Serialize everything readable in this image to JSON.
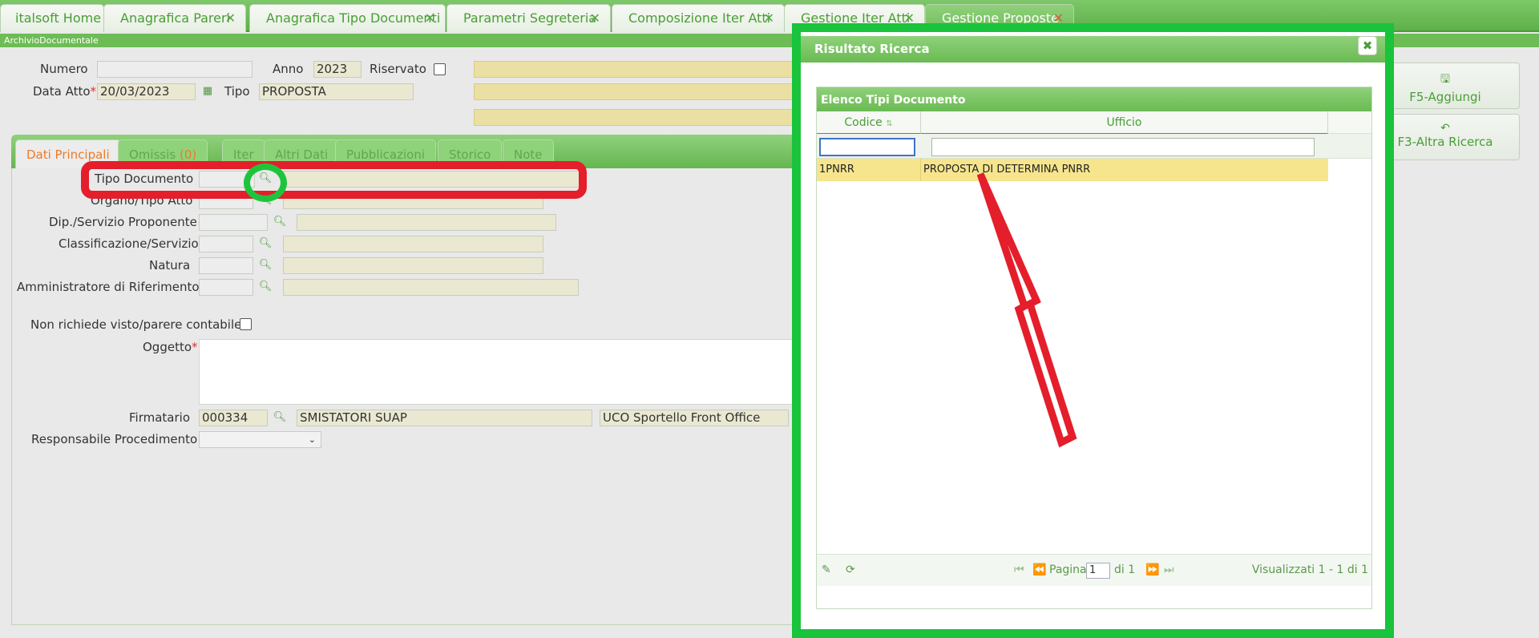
{
  "tabs": [
    {
      "label": "italsoft Home",
      "closable": false
    },
    {
      "label": "Anagrafica Pareri",
      "closable": true
    },
    {
      "label": "Anagrafica Tipo Documenti",
      "closable": true
    },
    {
      "label": "Parametri Segreteria",
      "closable": true
    },
    {
      "label": "Composizione Iter Atti",
      "closable": true
    },
    {
      "label": "Gestione Iter Atti",
      "closable": true
    },
    {
      "label": "Gestione Proposte",
      "closable": true,
      "active": true
    }
  ],
  "close_glyph": "✕",
  "subtitle": "ArchivioDocumentale",
  "form": {
    "numero_label": "Numero",
    "numero_value": "",
    "anno_label": "Anno",
    "anno_value": "2023",
    "riservato_label": "Riservato",
    "data_atto_label": "Data Atto",
    "data_atto_value": "20/03/2023",
    "tipo_label": "Tipo",
    "tipo_value": "PROPOSTA",
    "required_mark": "*"
  },
  "form_tabs": [
    {
      "label": "Dati Principali",
      "active": true
    },
    {
      "label": "Omissis",
      "count": "(0)"
    },
    {
      "label": "Iter"
    },
    {
      "label": "Altri Dati"
    },
    {
      "label": "Pubblicazioni"
    },
    {
      "label": "Storico"
    },
    {
      "label": "Note"
    }
  ],
  "fields": {
    "tipo_documento_label": "Tipo Documento",
    "organo_label": "Organo/Tipo Atto",
    "dip_label": "Dip./Servizio Proponente",
    "classificazione_label": "Classificazione/Servizio",
    "natura_label": "Natura",
    "amministratore_label": "Amministratore di Riferimento",
    "non_richiede_label": "Non richiede visto/parere contabile",
    "oggetto_label": "Oggetto",
    "firmatario_label": "Firmatario",
    "firmatario_code": "000334",
    "firmatario_name": "SMISTATORI SUAP",
    "firmatario_office": "UCO Sportello Front Office",
    "responsabile_label": "Responsabile Procedimento"
  },
  "actions": {
    "add_label": "F5-Aggiungi",
    "search_again_label": "F3-Altra Ricerca"
  },
  "dialog": {
    "title": "Risultato Ricerca",
    "close_label": "✖",
    "grid_caption": "Elenco Tipi Documento",
    "col_codice": "Codice",
    "col_ufficio": "Ufficio",
    "rows": [
      {
        "codice": "1PNRR",
        "ufficio": "PROPOSTA DI DETERMINA PNRR"
      }
    ],
    "pager": {
      "page_label": "Pagina",
      "page_value": "1",
      "of_label": "di 1",
      "summary": "Visualizzati 1 - 1 di 1"
    }
  },
  "icons": {
    "search": "search-icon",
    "calendar": "calendar-icon",
    "save": "save-icon",
    "undo": "undo-icon",
    "edit": "pencil-icon",
    "refresh": "refresh-icon"
  },
  "colors": {
    "accent_green": "#5eb04a",
    "annotation_red": "#e41e2b",
    "annotation_green": "#19c33b",
    "highlight_row": "#f6e58d"
  }
}
